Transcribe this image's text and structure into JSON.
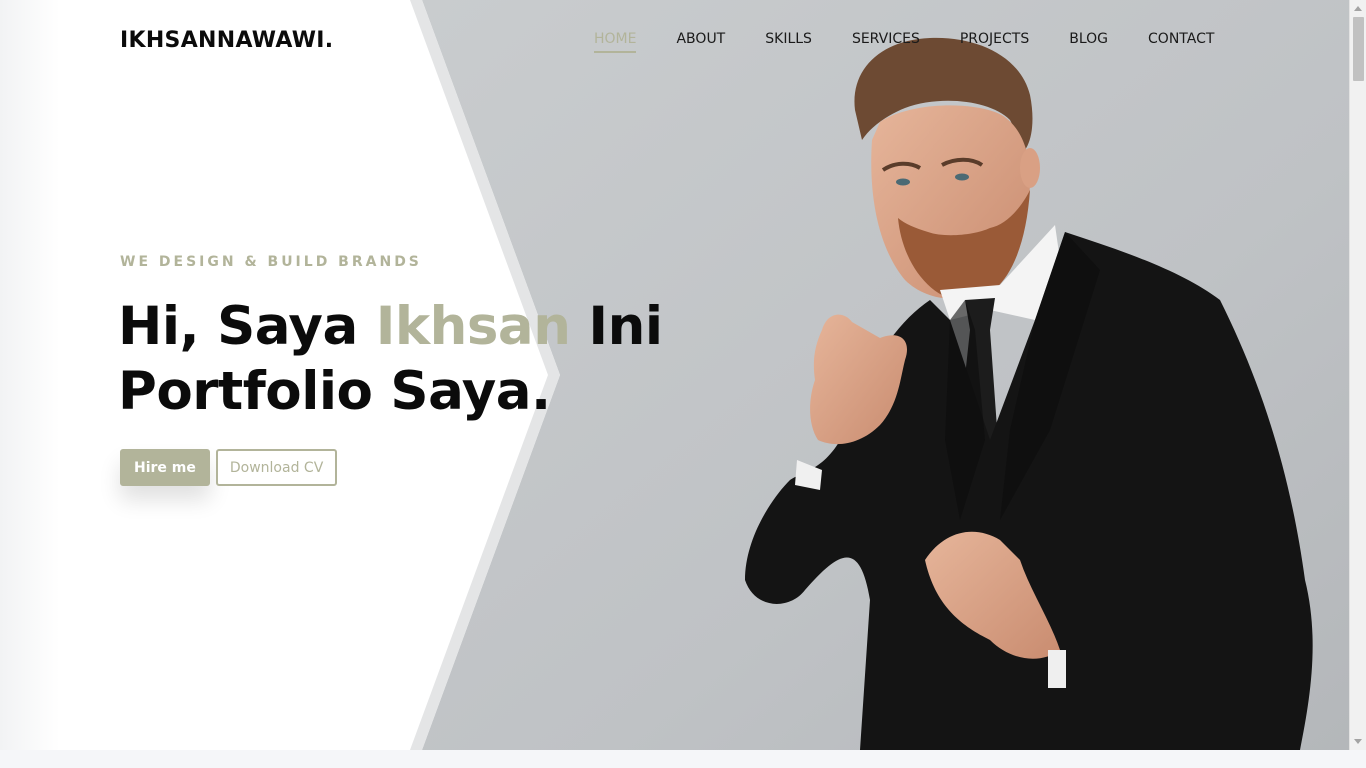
{
  "brand": {
    "logo_text": "IKHSANNAWAWI."
  },
  "nav": {
    "items": [
      {
        "label": "HOME",
        "active": true
      },
      {
        "label": "ABOUT"
      },
      {
        "label": "SKILLS"
      },
      {
        "label": "SERVICES"
      },
      {
        "label": "PROJECTS"
      },
      {
        "label": "BLOG"
      },
      {
        "label": "CONTACT"
      }
    ]
  },
  "hero": {
    "tagline": "WE DESIGN & BUILD BRANDS",
    "headline_part1": "Hi, Saya ",
    "headline_accent": "Ikhsan",
    "headline_part2": " Ini",
    "headline_line2": "Portfolio Saya.",
    "hire_button": "Hire me",
    "cv_button": "Download CV"
  },
  "colors": {
    "accent": "#b2b49a",
    "text_dark": "#0b0b0b",
    "photo_background": "#c2c5c8",
    "suit": "#141414"
  },
  "icons": {
    "photo": "man-in-suit-pointing-photo"
  }
}
